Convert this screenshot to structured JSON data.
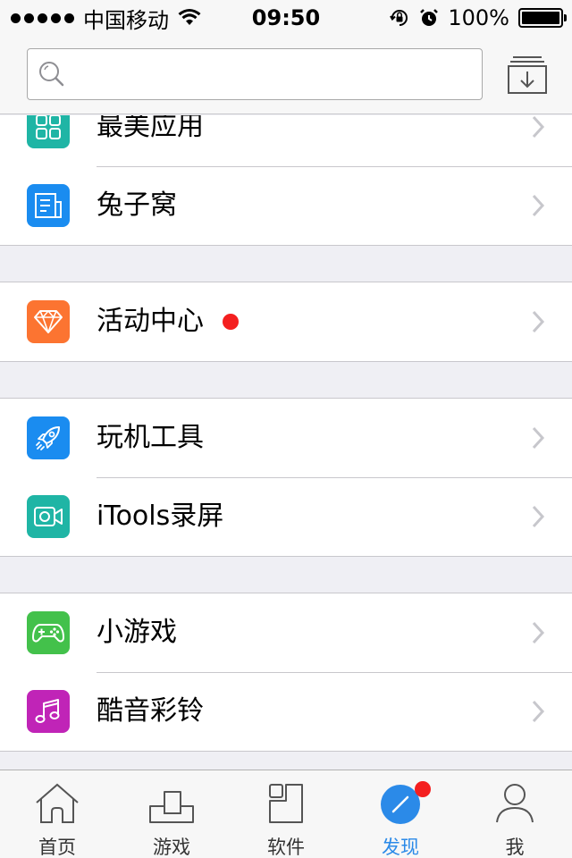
{
  "status_bar": {
    "carrier": "中国移动",
    "time": "09:50",
    "battery": "100%",
    "battery_level": 1.0
  },
  "search": {
    "placeholder": "",
    "icon": "search-icon"
  },
  "header": {
    "download_icon": "download-tray-icon"
  },
  "groups": [
    {
      "items": [
        {
          "label": "最美应用",
          "icon": "grid-icon",
          "color": "#1fb5a5"
        },
        {
          "label": "兔子窝",
          "icon": "document-icon",
          "color": "#1a8cf0"
        }
      ]
    },
    {
      "items": [
        {
          "label": "活动中心",
          "icon": "diamond-icon",
          "color": "#fc7431",
          "badge": true
        }
      ]
    },
    {
      "items": [
        {
          "label": "玩机工具",
          "icon": "rocket-icon",
          "color": "#1a8cf0"
        },
        {
          "label": "iTools录屏",
          "icon": "video-camera-icon",
          "color": "#1fb5a5"
        }
      ]
    },
    {
      "items": [
        {
          "label": "小游戏",
          "icon": "gamepad-icon",
          "color": "#43c14b"
        },
        {
          "label": "酷音彩铃",
          "icon": "music-note-icon",
          "color": "#c024b7"
        }
      ]
    }
  ],
  "tabs": [
    {
      "label": "首页",
      "icon": "home-icon",
      "active": false
    },
    {
      "label": "游戏",
      "icon": "tetris-icon",
      "active": false
    },
    {
      "label": "软件",
      "icon": "apps-icon",
      "active": false
    },
    {
      "label": "发现",
      "icon": "compass-icon",
      "active": true,
      "badge": true
    },
    {
      "label": "我",
      "icon": "user-icon",
      "active": false
    }
  ],
  "colors": {
    "accent": "#2b8ae8",
    "badge": "#f41f1f"
  }
}
